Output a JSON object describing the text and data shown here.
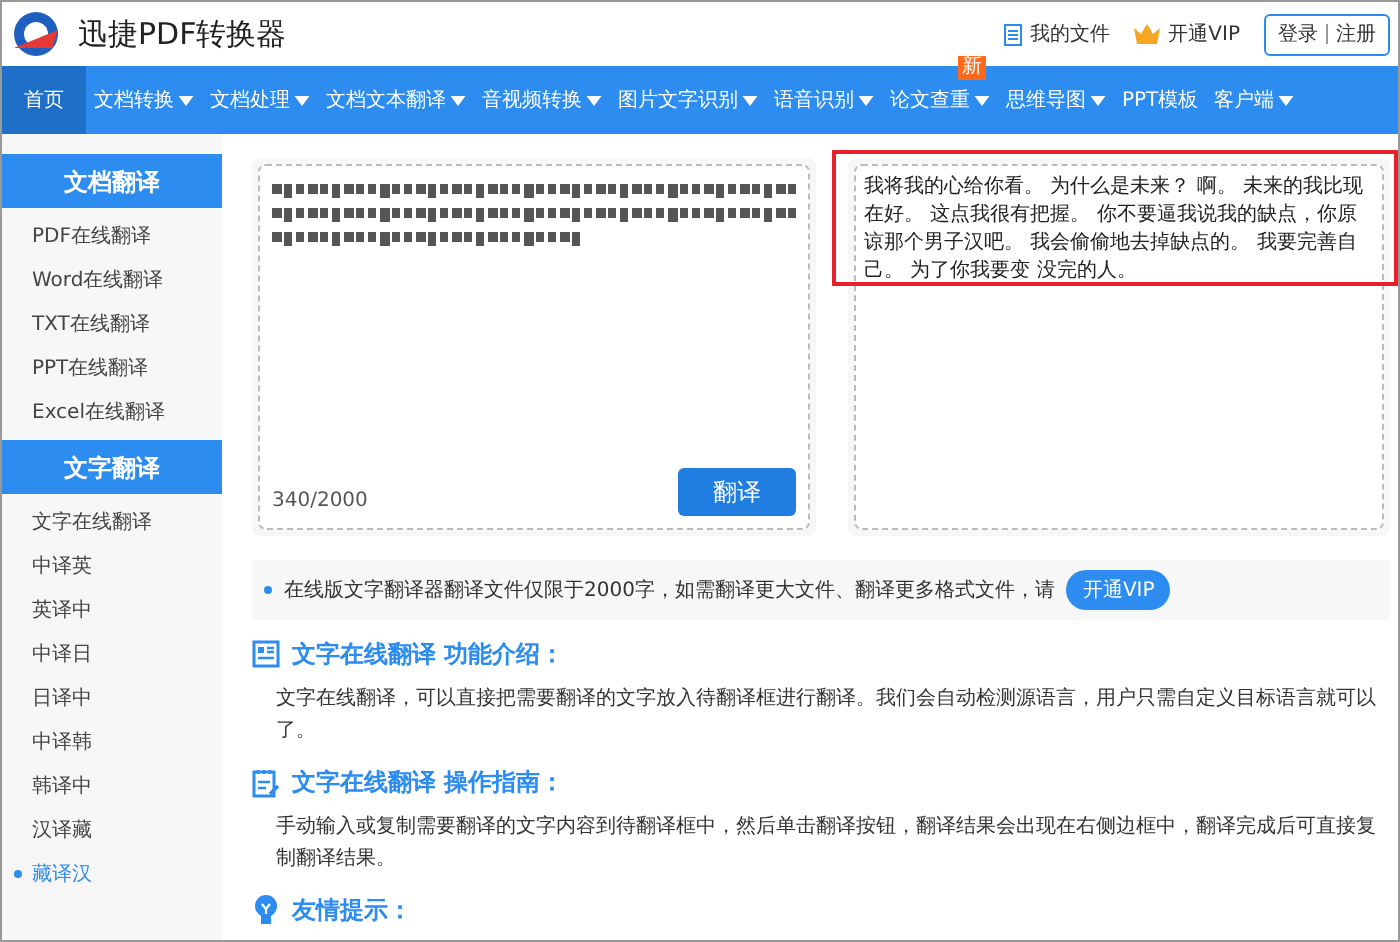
{
  "header": {
    "brand": "迅捷PDF转换器",
    "links": [
      {
        "kind": "file",
        "label": "我的文件"
      },
      {
        "kind": "vip",
        "label": "开通VIP"
      }
    ],
    "auth": [
      "登录",
      "注册"
    ]
  },
  "nav": [
    {
      "label": "首页",
      "selected": true,
      "dropdown": false
    },
    {
      "label": "文档转换",
      "selected": false,
      "dropdown": true
    },
    {
      "label": "文档处理",
      "selected": false,
      "dropdown": true
    },
    {
      "label": "文档文本翻译",
      "selected": false,
      "dropdown": true
    },
    {
      "label": "音视频转换",
      "selected": false,
      "dropdown": true
    },
    {
      "label": "图片文字识别",
      "selected": false,
      "dropdown": true
    },
    {
      "label": "语音识别",
      "selected": false,
      "dropdown": true
    },
    {
      "label": "论文查重",
      "selected": false,
      "dropdown": true,
      "badge": "新"
    },
    {
      "label": "思维导图",
      "selected": false,
      "dropdown": true
    },
    {
      "label": "PPT模板",
      "selected": false,
      "dropdown": false
    },
    {
      "label": "客户端",
      "selected": false,
      "dropdown": true
    }
  ],
  "sidebar": [
    {
      "title": "文档翻译",
      "items": [
        {
          "label": "PDF在线翻译",
          "selected": false
        },
        {
          "label": "Word在线翻译",
          "selected": false
        },
        {
          "label": "TXT在线翻译",
          "selected": false
        },
        {
          "label": "PPT在线翻译",
          "selected": false
        },
        {
          "label": "Excel在线翻译",
          "selected": false
        }
      ]
    },
    {
      "title": "文字翻译",
      "items": [
        {
          "label": "文字在线翻译",
          "selected": false
        },
        {
          "label": "中译英",
          "selected": false
        },
        {
          "label": "英译中",
          "selected": false
        },
        {
          "label": "中译日",
          "selected": false
        },
        {
          "label": "日译中",
          "selected": false
        },
        {
          "label": "中译韩",
          "selected": false
        },
        {
          "label": "韩译中",
          "selected": false
        },
        {
          "label": "汉译藏",
          "selected": false
        },
        {
          "label": "藏译汉",
          "selected": true
        }
      ]
    }
  ],
  "translator": {
    "counter": "340/2000",
    "button": "翻译",
    "output": "我将我的心给你看。 为什么是未来？ 啊。 未来的我比现在好。 这点我很有把握。 你不要逼我说我的缺点，你原谅那个男子汉吧。 我会偷偷地去掉缺点的。 我要完善自己。 为了你我要变 没完的人。",
    "output_highlighted": true
  },
  "notice": {
    "text": "在线版文字翻译器翻译文件仅限于2000字，如需翻译更大文件、翻译更多格式文件，请",
    "button": "开通VIP"
  },
  "sections": [
    {
      "kind": "intro",
      "title": "文字在线翻译 功能介绍：",
      "body": "文字在线翻译，可以直接把需要翻译的文字放入待翻译框进行翻译。我们会自动检测源语言，用户只需自定义目标语言就可以了。"
    },
    {
      "kind": "guide",
      "title": "文字在线翻译 操作指南：",
      "body": "手动输入或复制需要翻译的文字内容到待翻译框中，然后单击翻译按钮，翻译结果会出现在右侧边框中，翻译完成后可直接复制翻译结果。"
    },
    {
      "kind": "tip",
      "title": "友情提示："
    }
  ]
}
